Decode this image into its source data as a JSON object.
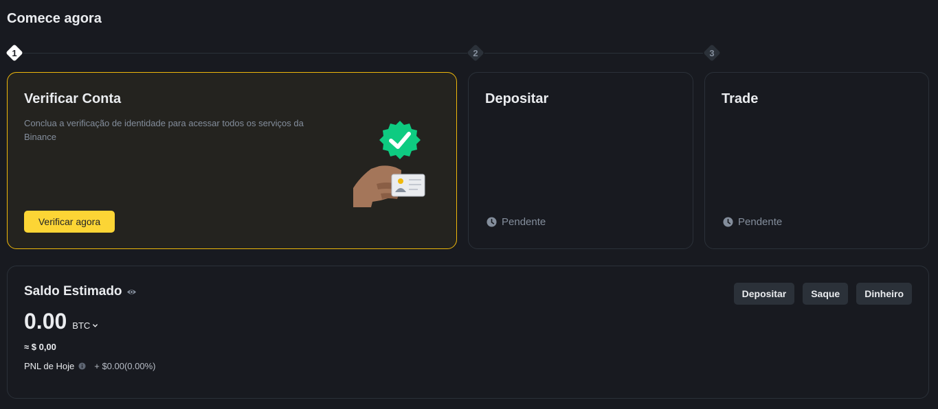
{
  "header": {
    "title": "Comece agora"
  },
  "steps": [
    {
      "number": "1",
      "state": "active"
    },
    {
      "number": "2",
      "state": "inactive"
    },
    {
      "number": "3",
      "state": "inactive"
    }
  ],
  "cards": {
    "verify": {
      "title": "Verificar Conta",
      "description": "Conclua a verificação de identidade para acessar todos os serviços da Binance",
      "button_label": "Verificar agora"
    },
    "deposit": {
      "title": "Depositar",
      "status": "Pendente"
    },
    "trade": {
      "title": "Trade",
      "status": "Pendente"
    }
  },
  "balance": {
    "title": "Saldo Estimado",
    "amount": "0.00",
    "currency": "BTC",
    "fiat_value": "≈ $ 0,00",
    "pnl_label": "PNL de Hoje",
    "pnl_value": "+ $0.00(0.00%)",
    "actions": {
      "deposit": "Depositar",
      "withdraw": "Saque",
      "cash": "Dinheiro"
    }
  },
  "colors": {
    "background": "#181a20",
    "accent": "#fcd535",
    "active_border": "#f0b90b",
    "badge_green": "#0ecb81",
    "muted_text": "#848e9c"
  },
  "icons": {
    "verified": "verified-badge-icon",
    "clock": "clock-icon",
    "eye": "eye-icon",
    "info": "info-icon",
    "chevron": "chevron-down-icon"
  }
}
